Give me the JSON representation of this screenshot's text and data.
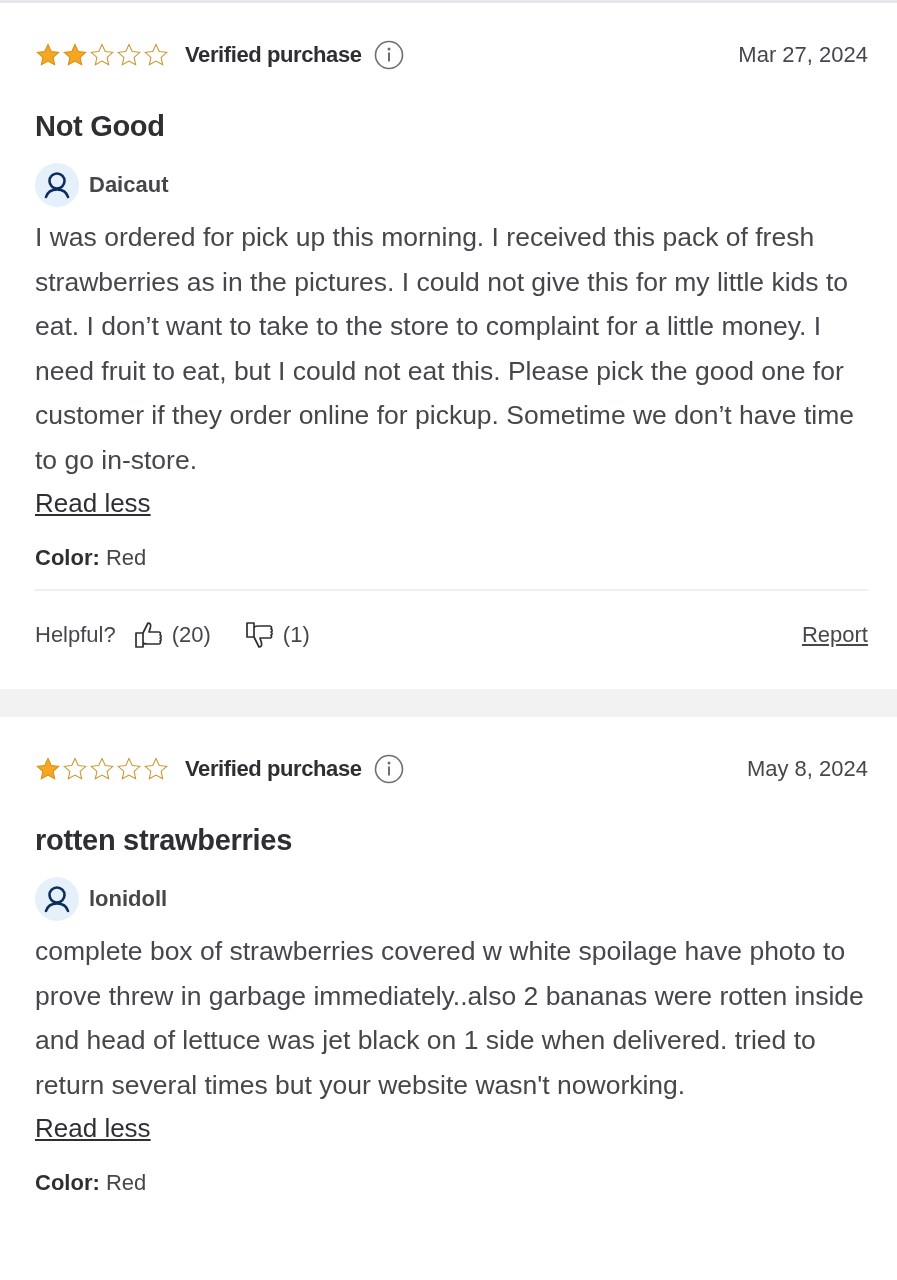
{
  "reviews": [
    {
      "stars": 2,
      "verified_label": "Verified purchase",
      "date": "Mar 27, 2024",
      "title": "Not Good",
      "author": "Daicaut",
      "text": "I was ordered for pick up this morning. I received this pack of fresh strawberries as in the pictures. I could not give this for my little kids to eat. I don’t want to take to the store to complaint for a little money. I need fruit to eat, but I could not eat this. Please pick the good one for customer if they order online for pickup. Sometime we don’t have time to go in-store.",
      "toggle": "Read less",
      "color_line": "**Color:** Red",
      "helpful": {
        "label": "Helpful?",
        "up": "(20)",
        "down": "(1)",
        "report": "Report"
      }
    },
    {
      "stars": 1,
      "verified_label": "Verified purchase",
      "date": "May 8, 2024",
      "title": "rotten strawberries",
      "author": "lonidoll",
      "text": "complete box of strawberries covered w white spoilage have photo to prove threw in garbage immediately..also 2 bananas were rotten inside and head of lettuce was jet black on 1 side when delivered. tried to return several times but your website wasn't noworking.",
      "toggle": "Read less",
      "color_line": "**Color:** Red"
    }
  ]
}
